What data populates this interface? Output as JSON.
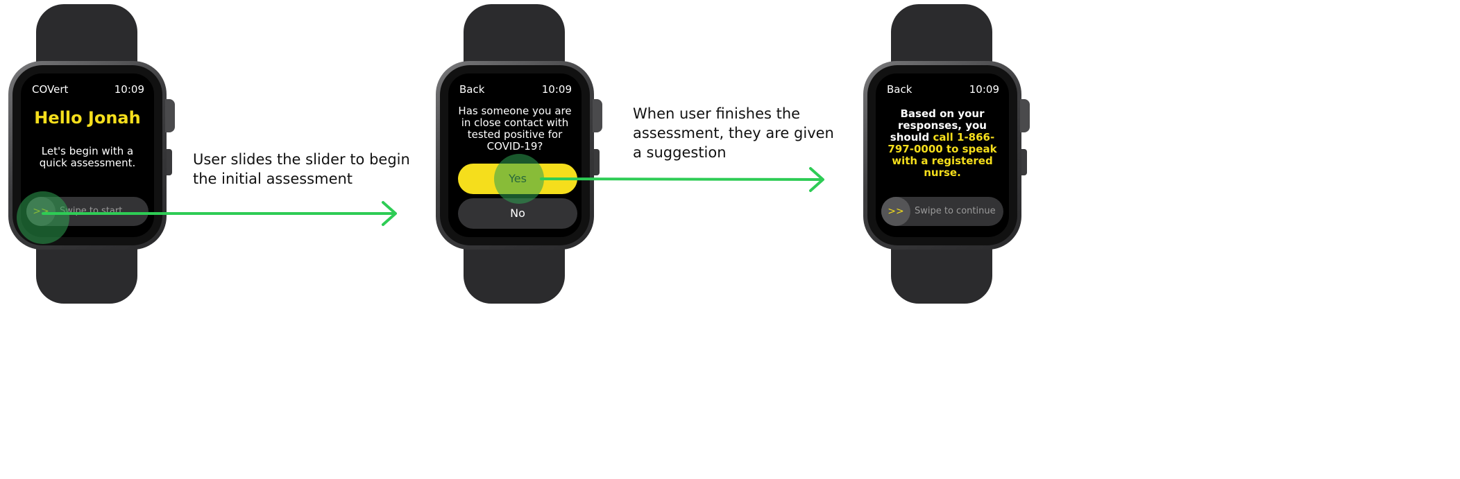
{
  "screens": [
    {
      "status_left": "COVert",
      "time": "10:09",
      "greeting": "Hello Jonah",
      "intro": "Let's begin with a quick assessment.",
      "swipe_knob": ">>",
      "swipe_label": "Swipe to start"
    },
    {
      "status_left": "Back",
      "time": "10:09",
      "question": "Has someone you are in close contact with tested positive for COVID-19?",
      "yes_label": "Yes",
      "no_label": "No"
    },
    {
      "status_left": "Back",
      "time": "10:09",
      "result_prefix": "Based on your responses, you should ",
      "result_highlight": "call 1-866-797-0000 to speak with a registered nurse.",
      "swipe_knob": ">>",
      "swipe_label": "Swipe to continue"
    }
  ],
  "captions": [
    "User slides the slider to begin the initial assessment",
    "When user finishes the assessment, they are given a suggestion"
  ],
  "colors": {
    "accent_yellow": "#f5de1c",
    "arrow_green": "#2ecc55",
    "screen_bg": "#000000",
    "band": "#2b2b2d"
  }
}
